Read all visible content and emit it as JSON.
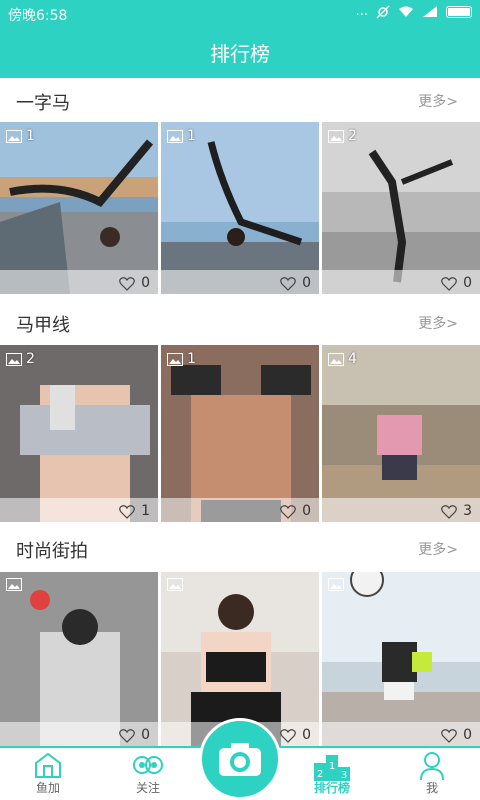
{
  "status_bar": {
    "time": "傍晚6:58",
    "dots": "...",
    "battery_color": "#ffffff"
  },
  "header": {
    "title": "排行榜"
  },
  "accent_color": "#2dd2c2",
  "sections": [
    {
      "title": "一字马",
      "more_label": "更多>",
      "tiles": [
        {
          "image_count": "1",
          "likes": "0"
        },
        {
          "image_count": "1",
          "likes": "0"
        },
        {
          "image_count": "2",
          "likes": "0"
        }
      ]
    },
    {
      "title": "马甲线",
      "more_label": "更多>",
      "tiles": [
        {
          "image_count": "2",
          "likes": "1"
        },
        {
          "image_count": "1",
          "likes": "0"
        },
        {
          "image_count": "4",
          "likes": "3"
        }
      ]
    },
    {
      "title": "时尚街拍",
      "more_label": "更多>",
      "tiles": [
        {
          "image_count": "",
          "likes": "0"
        },
        {
          "image_count": "",
          "likes": "0"
        },
        {
          "image_count": "",
          "likes": "0"
        }
      ]
    }
  ],
  "nav": {
    "items": [
      {
        "label": "鱼加",
        "icon": "house-icon"
      },
      {
        "label": "关注",
        "icon": "owl-icon"
      },
      {
        "label": "",
        "icon": "camera-icon"
      },
      {
        "label": "排行榜",
        "icon": "podium-icon"
      },
      {
        "label": "我",
        "icon": "person-icon"
      }
    ],
    "podium_numbers": [
      "2",
      "1",
      "3"
    ]
  }
}
